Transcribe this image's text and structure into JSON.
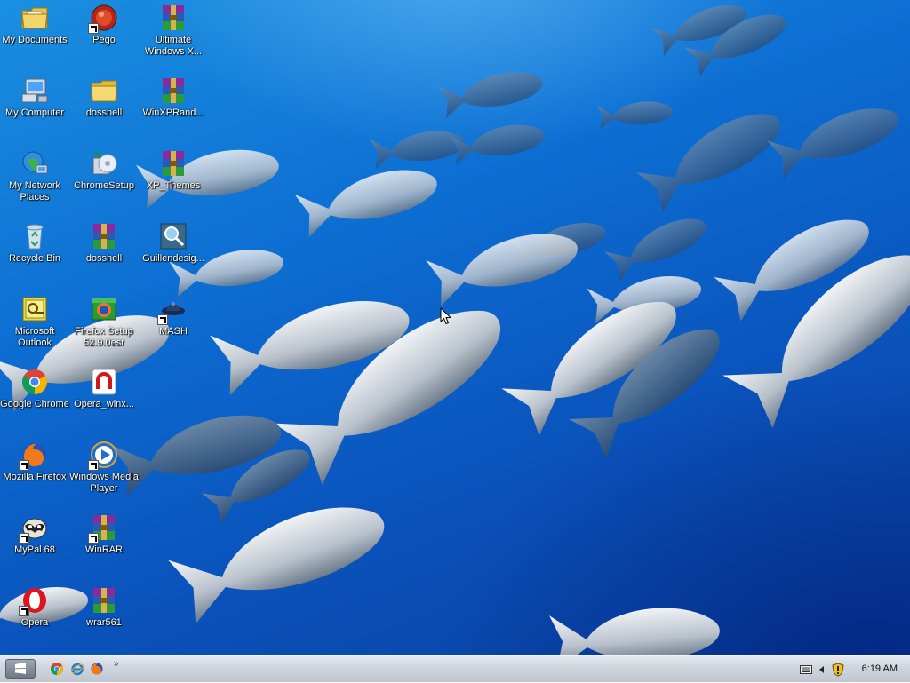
{
  "desktop": {
    "icons": [
      {
        "label": "My Documents",
        "icon": "my-documents-icon"
      },
      {
        "label": "Pego",
        "icon": "pego-icon",
        "shortcut": true
      },
      {
        "label": "Ultimate Windows X...",
        "icon": "winrar-archive-icon"
      },
      {
        "label": "My Computer",
        "icon": "my-computer-icon"
      },
      {
        "label": "dosshell",
        "icon": "folder-icon"
      },
      {
        "label": "WinXPRand...",
        "icon": "winrar-archive-icon"
      },
      {
        "label": "My Network Places",
        "icon": "my-network-places-icon"
      },
      {
        "label": "ChromeSetup",
        "icon": "chrome-setup-icon"
      },
      {
        "label": "XP_Themes",
        "icon": "winrar-archive-icon"
      },
      {
        "label": "Recycle Bin",
        "icon": "recycle-bin-icon"
      },
      {
        "label": "dosshell",
        "icon": "winrar-archive-icon"
      },
      {
        "label": "Guillendesig...",
        "icon": "image-viewer-icon"
      },
      {
        "label": "Microsoft Outlook",
        "icon": "outlook-icon"
      },
      {
        "label": "Firefox Setup 52.9.0esr",
        "icon": "firefox-setup-icon"
      },
      {
        "label": "MASH",
        "icon": "mash-icon",
        "shortcut": true
      },
      {
        "label": "Google Chrome",
        "icon": "chrome-icon"
      },
      {
        "label": "Opera_winx...",
        "icon": "opera-installer-icon"
      },
      {
        "label": "Mozilla Firefox",
        "icon": "firefox-icon",
        "shortcut": true
      },
      {
        "label": "Windows Media Player",
        "icon": "media-player-icon",
        "shortcut": true
      },
      {
        "label": "MyPal 68",
        "icon": "mypal-icon",
        "shortcut": true
      },
      {
        "label": "WinRAR",
        "icon": "winrar-icon",
        "shortcut": true
      },
      {
        "label": "Opera",
        "icon": "opera-icon",
        "shortcut": true
      },
      {
        "label": "wrar561",
        "icon": "winrar-archive-icon"
      }
    ]
  },
  "taskbar": {
    "start_icon": "windows-logo-icon",
    "quick_launch": [
      "chrome-icon",
      "internet-explorer-icon",
      "firefox-icon"
    ],
    "overflow": "»",
    "tray_icons": [
      "keyboard-icon",
      "show-hidden-arrow-icon",
      "security-shield-icon"
    ],
    "clock": "6:19 AM"
  },
  "colors": {
    "wallpaper_blue": "#0d6fd3",
    "taskbar": "#cfd5dd",
    "winrar_purple": "#7a2a8a"
  }
}
